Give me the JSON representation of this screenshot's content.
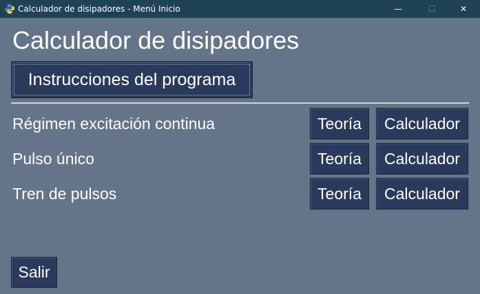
{
  "window": {
    "title": "Calculador de disipadores - Menú Inicio",
    "minimize_glyph": "—",
    "maximize_glyph": "☐",
    "close_glyph": "✕"
  },
  "app": {
    "title": "Calculador de disipadores",
    "instructions_button": "Instrucciones del programa"
  },
  "rows": [
    {
      "label": "Régimen excitación continua",
      "theory_button": "Teoría",
      "calc_button": "Calculador"
    },
    {
      "label": "Pulso único",
      "theory_button": "Teoría",
      "calc_button": "Calculador"
    },
    {
      "label": "Tren de pulsos",
      "theory_button": "Teoría",
      "calc_button": "Calculador"
    }
  ],
  "footer": {
    "exit_button": "Salir"
  },
  "colors": {
    "background": "#64758a",
    "titlebar": "#1f4257",
    "button": "#2a3a5c",
    "text": "#ffffff"
  },
  "icons": {
    "app_icon": "python-logo-icon"
  }
}
